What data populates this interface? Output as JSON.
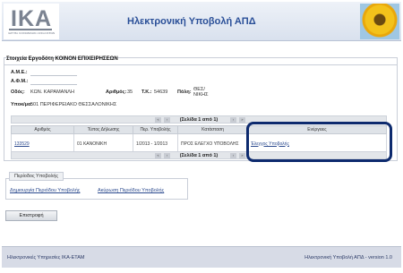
{
  "header": {
    "logo_text": "IKA",
    "logo_subtitle": "ΙΔΡΥΜΑ ΚΟΙΝΩΝΙΚΩΝ ΑΣΦΑΛΙΣΕΩΝ",
    "title": "Ηλεκτρονική Υποβολή ΑΠΔ"
  },
  "employer": {
    "section_title": "Στοιχεία Εργοδότη ΚΟΙΝΟΝ ΕΠΙΧΕΙΡΗΣΕΩΝ",
    "ame_label": "Α.Μ.Ε.:",
    "ame_value": "",
    "afm_label": "Α.Φ.Μ.:",
    "afm_value": "",
    "street_label": "Οδός:",
    "street_value": "ΚΩΝ. ΚΑΡΑΜΑΝΛΗ",
    "number_label": "Αριθμός:",
    "number_value": "35",
    "zip_label": "Τ.Κ.:",
    "zip_value": "54639",
    "city_label": "Πόλη:",
    "city_value": "ΘΕΣ/ΝΙΚΗΣ",
    "branch_label": "Υποκ/μα:",
    "branch_value": "501 ΠΕΡΙΦΕΡΕΙΑΚΟ ΘΕΣΣΑΛΟΝΙΚΗΣ"
  },
  "pager": {
    "text": "(Σελίδα 1 από 1)"
  },
  "table": {
    "headers": [
      "Αριθμός",
      "Τύπος Δήλωσης",
      "Περ. Υποβολής",
      "Κατάσταση",
      "Ενέργειες"
    ],
    "rows": [
      {
        "number": "133529",
        "type": "01 ΚΑΝΟΝΙΚΗ",
        "period": "1/2013 - 1/2013",
        "status": "ΠΡΟΣ ΕΛΕΓΧΟ ΥΠΟΒΟΛΗΣ",
        "action": "Έλεγχος Υποβολής"
      }
    ]
  },
  "submission_period": {
    "title": "Περίοδος Υποβολής",
    "create_link": "Δημιουργία Περιόδου Υποβολής",
    "cancel_link": "Ακύρωση Περιόδου Υποβολής"
  },
  "back_button": "Επιστροφή",
  "footer": {
    "left": "Ηλεκτρονικές Υπηρεσίες ΙΚΑ-ΕΤΑΜ",
    "right": "Ηλεκτρονική Υποβολή ΑΠΔ - version 1.0"
  }
}
